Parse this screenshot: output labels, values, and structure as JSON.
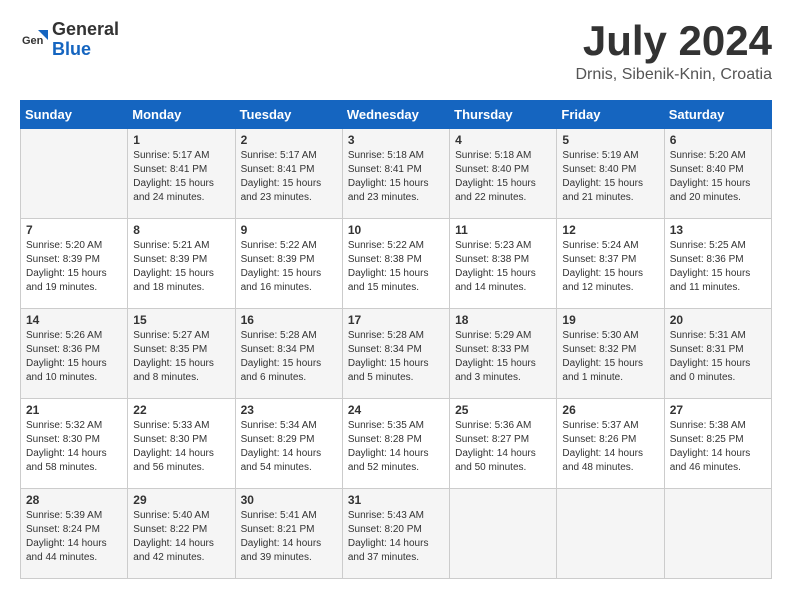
{
  "header": {
    "logo_general": "General",
    "logo_blue": "Blue",
    "month": "July 2024",
    "location": "Drnis, Sibenik-Knin, Croatia"
  },
  "columns": [
    "Sunday",
    "Monday",
    "Tuesday",
    "Wednesday",
    "Thursday",
    "Friday",
    "Saturday"
  ],
  "weeks": [
    [
      {
        "day": "",
        "info": ""
      },
      {
        "day": "1",
        "info": "Sunrise: 5:17 AM\nSunset: 8:41 PM\nDaylight: 15 hours\nand 24 minutes."
      },
      {
        "day": "2",
        "info": "Sunrise: 5:17 AM\nSunset: 8:41 PM\nDaylight: 15 hours\nand 23 minutes."
      },
      {
        "day": "3",
        "info": "Sunrise: 5:18 AM\nSunset: 8:41 PM\nDaylight: 15 hours\nand 23 minutes."
      },
      {
        "day": "4",
        "info": "Sunrise: 5:18 AM\nSunset: 8:40 PM\nDaylight: 15 hours\nand 22 minutes."
      },
      {
        "day": "5",
        "info": "Sunrise: 5:19 AM\nSunset: 8:40 PM\nDaylight: 15 hours\nand 21 minutes."
      },
      {
        "day": "6",
        "info": "Sunrise: 5:20 AM\nSunset: 8:40 PM\nDaylight: 15 hours\nand 20 minutes."
      }
    ],
    [
      {
        "day": "7",
        "info": "Sunrise: 5:20 AM\nSunset: 8:39 PM\nDaylight: 15 hours\nand 19 minutes."
      },
      {
        "day": "8",
        "info": "Sunrise: 5:21 AM\nSunset: 8:39 PM\nDaylight: 15 hours\nand 18 minutes."
      },
      {
        "day": "9",
        "info": "Sunrise: 5:22 AM\nSunset: 8:39 PM\nDaylight: 15 hours\nand 16 minutes."
      },
      {
        "day": "10",
        "info": "Sunrise: 5:22 AM\nSunset: 8:38 PM\nDaylight: 15 hours\nand 15 minutes."
      },
      {
        "day": "11",
        "info": "Sunrise: 5:23 AM\nSunset: 8:38 PM\nDaylight: 15 hours\nand 14 minutes."
      },
      {
        "day": "12",
        "info": "Sunrise: 5:24 AM\nSunset: 8:37 PM\nDaylight: 15 hours\nand 12 minutes."
      },
      {
        "day": "13",
        "info": "Sunrise: 5:25 AM\nSunset: 8:36 PM\nDaylight: 15 hours\nand 11 minutes."
      }
    ],
    [
      {
        "day": "14",
        "info": "Sunrise: 5:26 AM\nSunset: 8:36 PM\nDaylight: 15 hours\nand 10 minutes."
      },
      {
        "day": "15",
        "info": "Sunrise: 5:27 AM\nSunset: 8:35 PM\nDaylight: 15 hours\nand 8 minutes."
      },
      {
        "day": "16",
        "info": "Sunrise: 5:28 AM\nSunset: 8:34 PM\nDaylight: 15 hours\nand 6 minutes."
      },
      {
        "day": "17",
        "info": "Sunrise: 5:28 AM\nSunset: 8:34 PM\nDaylight: 15 hours\nand 5 minutes."
      },
      {
        "day": "18",
        "info": "Sunrise: 5:29 AM\nSunset: 8:33 PM\nDaylight: 15 hours\nand 3 minutes."
      },
      {
        "day": "19",
        "info": "Sunrise: 5:30 AM\nSunset: 8:32 PM\nDaylight: 15 hours\nand 1 minute."
      },
      {
        "day": "20",
        "info": "Sunrise: 5:31 AM\nSunset: 8:31 PM\nDaylight: 15 hours\nand 0 minutes."
      }
    ],
    [
      {
        "day": "21",
        "info": "Sunrise: 5:32 AM\nSunset: 8:30 PM\nDaylight: 14 hours\nand 58 minutes."
      },
      {
        "day": "22",
        "info": "Sunrise: 5:33 AM\nSunset: 8:30 PM\nDaylight: 14 hours\nand 56 minutes."
      },
      {
        "day": "23",
        "info": "Sunrise: 5:34 AM\nSunset: 8:29 PM\nDaylight: 14 hours\nand 54 minutes."
      },
      {
        "day": "24",
        "info": "Sunrise: 5:35 AM\nSunset: 8:28 PM\nDaylight: 14 hours\nand 52 minutes."
      },
      {
        "day": "25",
        "info": "Sunrise: 5:36 AM\nSunset: 8:27 PM\nDaylight: 14 hours\nand 50 minutes."
      },
      {
        "day": "26",
        "info": "Sunrise: 5:37 AM\nSunset: 8:26 PM\nDaylight: 14 hours\nand 48 minutes."
      },
      {
        "day": "27",
        "info": "Sunrise: 5:38 AM\nSunset: 8:25 PM\nDaylight: 14 hours\nand 46 minutes."
      }
    ],
    [
      {
        "day": "28",
        "info": "Sunrise: 5:39 AM\nSunset: 8:24 PM\nDaylight: 14 hours\nand 44 minutes."
      },
      {
        "day": "29",
        "info": "Sunrise: 5:40 AM\nSunset: 8:22 PM\nDaylight: 14 hours\nand 42 minutes."
      },
      {
        "day": "30",
        "info": "Sunrise: 5:41 AM\nSunset: 8:21 PM\nDaylight: 14 hours\nand 39 minutes."
      },
      {
        "day": "31",
        "info": "Sunrise: 5:43 AM\nSunset: 8:20 PM\nDaylight: 14 hours\nand 37 minutes."
      },
      {
        "day": "",
        "info": ""
      },
      {
        "day": "",
        "info": ""
      },
      {
        "day": "",
        "info": ""
      }
    ]
  ]
}
